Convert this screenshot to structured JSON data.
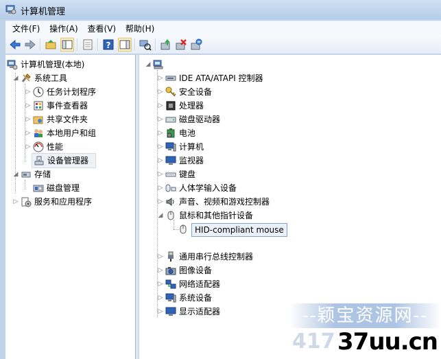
{
  "window": {
    "title": "计算机管理"
  },
  "menu": [
    {
      "label": "文件(F)"
    },
    {
      "label": "操作(A)"
    },
    {
      "label": "查看(V)"
    },
    {
      "label": "帮助(H)"
    }
  ],
  "left_tree": [
    {
      "label": "计算机管理(本地)",
      "level": 0,
      "arrow": "",
      "icon": "computer-management-icon"
    },
    {
      "label": "系统工具",
      "level": 1,
      "arrow": "◢",
      "icon": "system-tools-icon"
    },
    {
      "label": "任务计划程序",
      "level": 2,
      "arrow": "▷",
      "icon": "clock-icon"
    },
    {
      "label": "事件查看器",
      "level": 2,
      "arrow": "▷",
      "icon": "event-viewer-icon"
    },
    {
      "label": "共享文件夹",
      "level": 2,
      "arrow": "▷",
      "icon": "shared-folder-icon"
    },
    {
      "label": "本地用户和组",
      "level": 2,
      "arrow": "▷",
      "icon": "users-icon"
    },
    {
      "label": "性能",
      "level": 2,
      "arrow": "▷",
      "icon": "performance-icon"
    },
    {
      "label": "设备管理器",
      "level": 2,
      "arrow": "",
      "icon": "device-manager-icon",
      "selected": true
    },
    {
      "label": "存储",
      "level": 1,
      "arrow": "◢",
      "icon": "storage-icon"
    },
    {
      "label": "磁盘管理",
      "level": 2,
      "arrow": "",
      "icon": "disk-management-icon"
    },
    {
      "label": "服务和应用程序",
      "level": 1,
      "arrow": "▷",
      "icon": "services-icon"
    }
  ],
  "right_tree": {
    "root_icon": "computer-root-icon",
    "items": [
      {
        "label": "IDE ATA/ATAPI 控制器",
        "arrow": "▷",
        "icon": "ide-controller-icon"
      },
      {
        "label": "安全设备",
        "arrow": "▷",
        "icon": "key-icon"
      },
      {
        "label": "处理器",
        "arrow": "▷",
        "icon": "processor-icon"
      },
      {
        "label": "磁盘驱动器",
        "arrow": "▷",
        "icon": "disk-drive-icon"
      },
      {
        "label": "电池",
        "arrow": "▷",
        "icon": "battery-icon"
      },
      {
        "label": "计算机",
        "arrow": "▷",
        "icon": "computer-icon"
      },
      {
        "label": "监视器",
        "arrow": "▷",
        "icon": "monitor-icon"
      },
      {
        "label": "键盘",
        "arrow": "▷",
        "icon": "keyboard-icon"
      },
      {
        "label": "人体学输入设备",
        "arrow": "▷",
        "icon": "hid-icon"
      },
      {
        "label": "声音、视频和游戏控制器",
        "arrow": "▷",
        "icon": "sound-icon"
      },
      {
        "label": "鼠标和其他指针设备",
        "arrow": "◢",
        "icon": "mouse-icon"
      },
      {
        "label": "HID-compliant mouse",
        "arrow": "",
        "icon": "mouse-icon",
        "child": true
      },
      {
        "label": "通用串行总线控制器",
        "arrow": "▷",
        "icon": "usb-icon"
      },
      {
        "label": "图像设备",
        "arrow": "▷",
        "icon": "camera-icon"
      },
      {
        "label": "网络适配器",
        "arrow": "▷",
        "icon": "network-adapter-icon"
      },
      {
        "label": "系统设备",
        "arrow": "▷",
        "icon": "system-device-icon"
      },
      {
        "label": "显示适配器",
        "arrow": "▷",
        "icon": "display-adapter-icon"
      }
    ]
  },
  "watermark": {
    "line1": "--颖宝资源网--",
    "line2": "417",
    "line3": "37uu.cn"
  }
}
